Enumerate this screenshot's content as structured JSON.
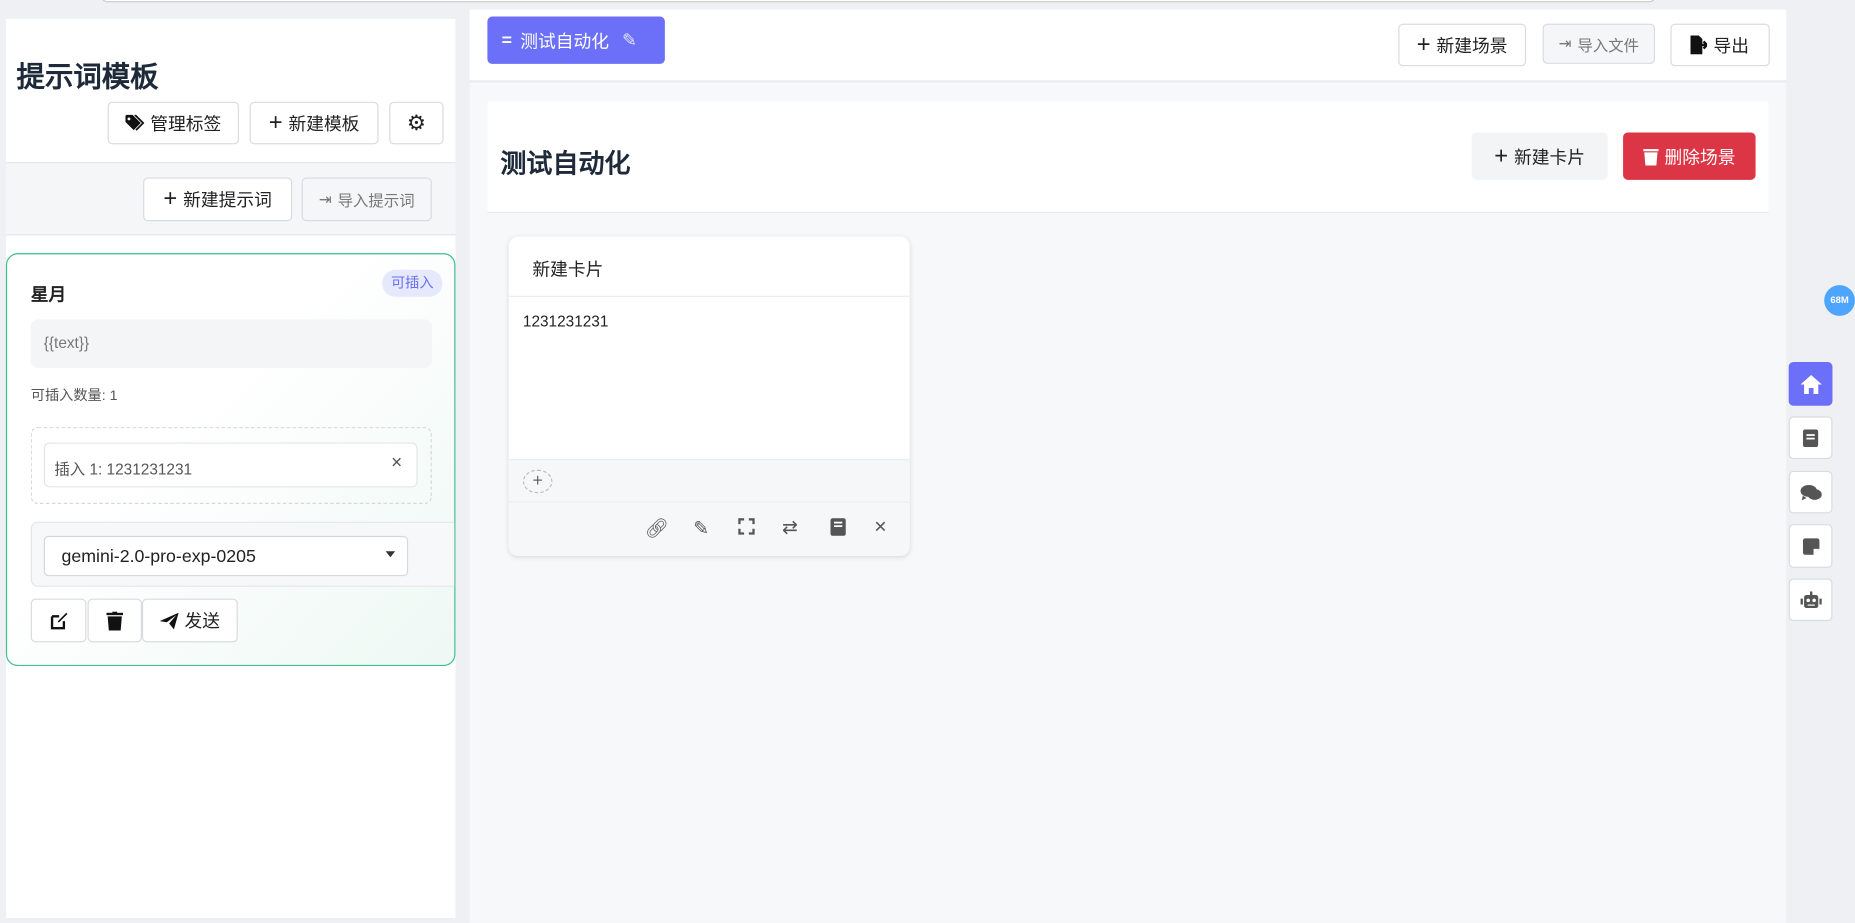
{
  "left_panel": {
    "title": "提示词模板",
    "manage_tags": "管理标签",
    "new_template": "新建模板",
    "new_prompt": "新建提示词",
    "import_prompt": "导入提示词",
    "card": {
      "name": "星月",
      "badge": "可插入",
      "template": "{{text}}",
      "insert_count": "可插入数量: 1",
      "insert_item": "插入 1: 1231231231",
      "model": "gemini-2.0-pro-exp-0205",
      "send": "发送"
    }
  },
  "topbar": {
    "scene_tab": "测试自动化",
    "new_scene": "新建场景",
    "import_file": "导入文件",
    "export": "导出"
  },
  "scene": {
    "title": "测试自动化",
    "new_card": "新建卡片",
    "delete_scene": "删除场景",
    "cards": [
      {
        "title": "新建卡片",
        "content": "1231231231"
      }
    ]
  },
  "right_sidebar": {
    "memory_badge": "68M"
  },
  "colors": {
    "accent": "#6c6ff7",
    "danger": "#dc3545",
    "card_border": "#3dbf8a",
    "badge_blue": "#4ea5ff"
  }
}
